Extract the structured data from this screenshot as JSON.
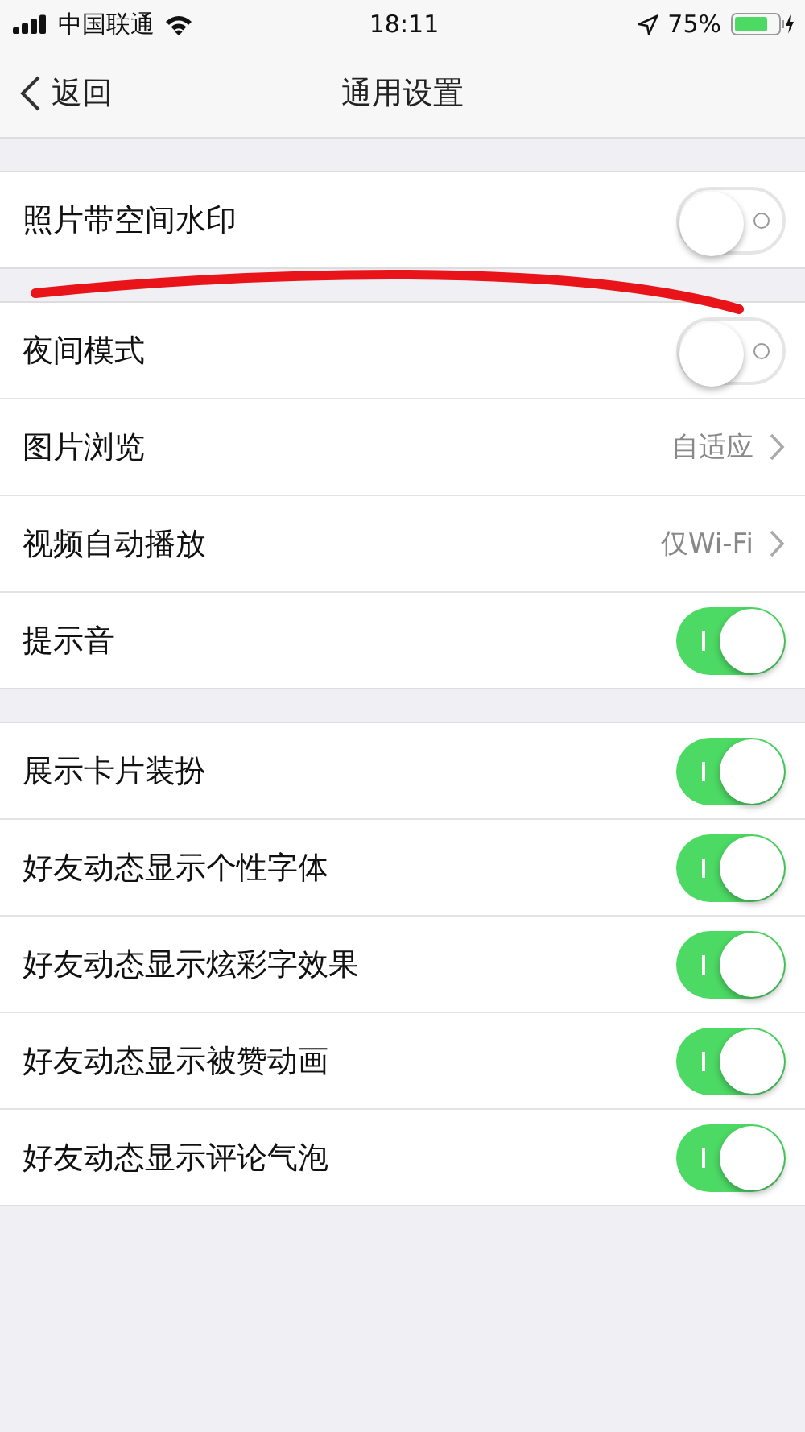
{
  "status_bar": {
    "carrier": "中国联通",
    "time": "18:11",
    "battery": "75%"
  },
  "nav": {
    "back": "返回",
    "title": "通用设置"
  },
  "sections": [
    {
      "rows": [
        {
          "kind": "toggle",
          "label": "照片带空间水印",
          "on": false
        }
      ]
    },
    {
      "rows": [
        {
          "kind": "toggle",
          "label": "夜间模式",
          "on": false
        },
        {
          "kind": "link",
          "label": "图片浏览",
          "value": "自适应"
        },
        {
          "kind": "link",
          "label": "视频自动播放",
          "value": "仅Wi-Fi"
        },
        {
          "kind": "toggle",
          "label": "提示音",
          "on": true
        }
      ]
    },
    {
      "rows": [
        {
          "kind": "toggle",
          "label": "展示卡片装扮",
          "on": true
        },
        {
          "kind": "toggle",
          "label": "好友动态显示个性字体",
          "on": true
        },
        {
          "kind": "toggle",
          "label": "好友动态显示炫彩字效果",
          "on": true
        },
        {
          "kind": "toggle",
          "label": "好友动态显示被赞动画",
          "on": true
        },
        {
          "kind": "toggle",
          "label": "好友动态显示评论气泡",
          "on": true
        }
      ]
    }
  ]
}
